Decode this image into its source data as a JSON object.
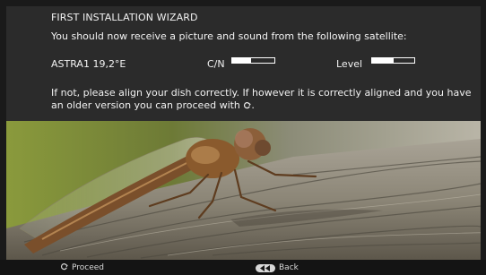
{
  "wizard": {
    "title": "FIRST INSTALLATION WIZARD",
    "instruction": "You should now receive a picture and sound from the following satellite:",
    "satellite_name": "ASTRA1 19,2°E",
    "cn_label": "C/N",
    "level_label": "Level",
    "cn_signal_fraction": 0.45,
    "level_signal_fraction": 0.5,
    "help_text_part1": "If not, please align your dish correctly. If however it is correctly aligned and you have an older version you can proceed with ",
    "help_text_part2": "."
  },
  "footer": {
    "proceed_label": "Proceed",
    "back_label": "Back",
    "proceed_icon": "ok-circle-arrow-icon",
    "back_icon": "back-key-icon"
  },
  "colors": {
    "panel_bg": "#2b2b2b",
    "bar_bg": "#141414",
    "text": "#f2f2f2"
  }
}
